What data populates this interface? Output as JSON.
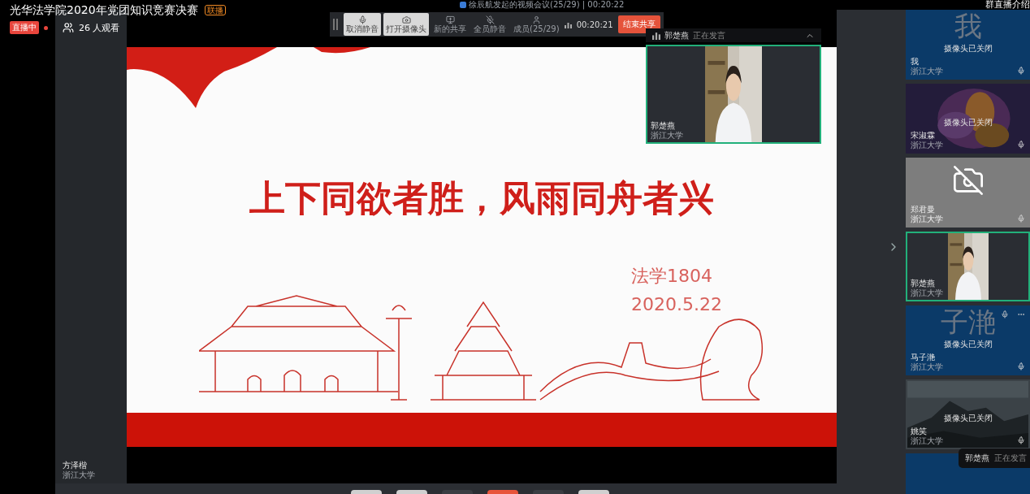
{
  "stream": {
    "title": "光华法学院2020年党团知识竞赛决赛",
    "badge": "联播",
    "live_label": "直播中",
    "live": true,
    "viewers": "26 人观看"
  },
  "meeting_banner": "徐辰航发起的视频会议(25/29) | 00:20:22",
  "intro_link": "群直播介绍",
  "toolbar": {
    "buttons": [
      {
        "label": "取消静音",
        "highlighted": true
      },
      {
        "label": "打开摄像头",
        "highlighted": true
      },
      {
        "label": "新的共享",
        "highlighted": false
      },
      {
        "label": "全员静音",
        "highlighted": false
      },
      {
        "label": "成员(25/29)",
        "highlighted": false
      }
    ],
    "timer": "00:20:21",
    "end_button": "结束共享"
  },
  "speaker_bar": {
    "name": "郭楚燕",
    "status": "正在发言"
  },
  "speaker_video": {
    "name": "郭楚燕",
    "org": "浙江大学"
  },
  "slide": {
    "headline": "上下同欲者胜，风雨同舟者兴",
    "class": "法学1804",
    "date": "2020.5.22"
  },
  "side_participant": {
    "name": "方泽楷",
    "org": "浙江大学"
  },
  "participants": [
    {
      "kind": "avatar",
      "name": "我",
      "org": "浙江大学",
      "avatar_text": "我",
      "camera_note": "摄像头已关闭",
      "speaking": false
    },
    {
      "kind": "backdrop",
      "name": "宋淑霖",
      "org": "浙江大学",
      "camera_note": "摄像头已关闭",
      "speaking": false
    },
    {
      "kind": "camera_off",
      "name": "郑君曼",
      "org": "浙江大学",
      "speaking": false
    },
    {
      "kind": "video",
      "name": "郭楚燕",
      "org": "浙江大学",
      "speaking": true
    },
    {
      "kind": "avatar",
      "name": "马子滟",
      "org": "浙江大学",
      "avatar_text": "子滟",
      "camera_note": "摄像头已关闭",
      "speaking": false
    },
    {
      "kind": "landscape",
      "name": "姚笑",
      "org": "浙江大学",
      "camera_note": "摄像头已关闭",
      "speaking": false
    },
    {
      "kind": "blank",
      "speaking": false
    }
  ],
  "speaking_toast": {
    "name": "郭楚燕",
    "status": "正在发言"
  }
}
